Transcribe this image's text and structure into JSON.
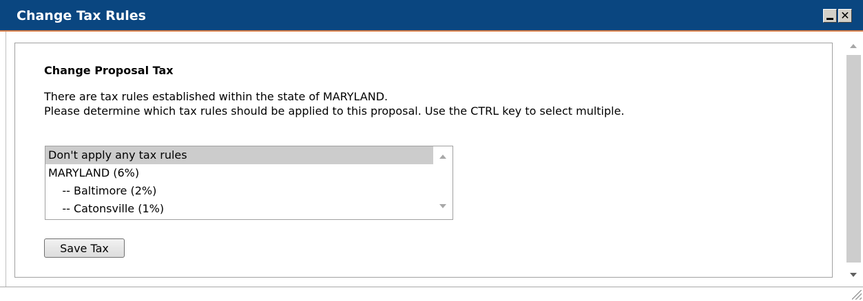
{
  "window": {
    "title": "Change Tax Rules",
    "close_glyph": "✕",
    "titlebar_color": "#0a4680",
    "accent_color": "#d9814a"
  },
  "form": {
    "heading": "Change Proposal Tax",
    "description_line1": "There are tax rules established within the state of MARYLAND.",
    "description_line2": "Please determine which tax rules should be applied to this proposal. Use the CTRL key to select multiple.",
    "tax_options": [
      {
        "label": "Don't apply any tax rules",
        "selected": true
      },
      {
        "label": "MARYLAND (6%)",
        "selected": false
      },
      {
        "label": "    -- Baltimore (2%)",
        "selected": false
      },
      {
        "label": "    -- Catonsville (1%)",
        "selected": false
      }
    ],
    "save_label": "Save Tax"
  }
}
